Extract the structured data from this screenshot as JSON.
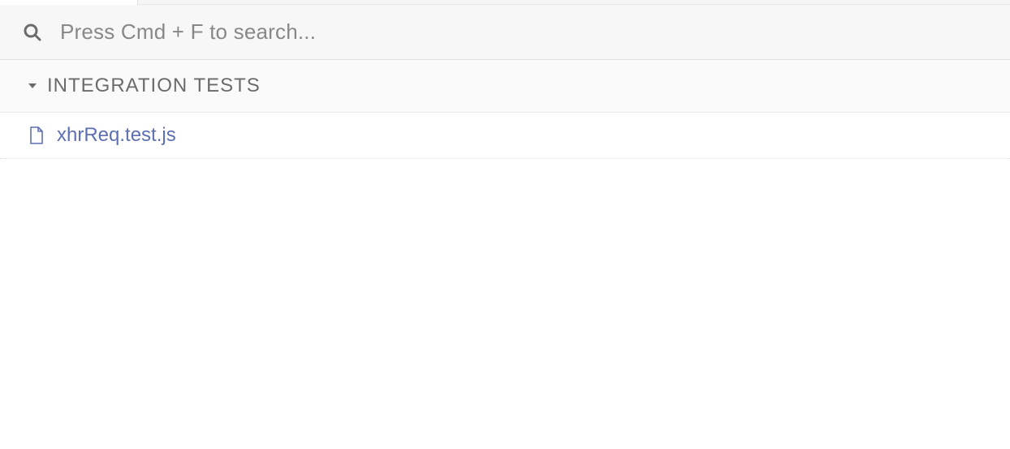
{
  "search": {
    "placeholder": "Press Cmd + F to search..."
  },
  "section": {
    "title": "INTEGRATION TESTS"
  },
  "files": [
    {
      "name": "xhrReq.test.js"
    }
  ],
  "colors": {
    "link": "#5e6fb3",
    "muted": "#888888",
    "section_text": "#6b6b6b"
  }
}
